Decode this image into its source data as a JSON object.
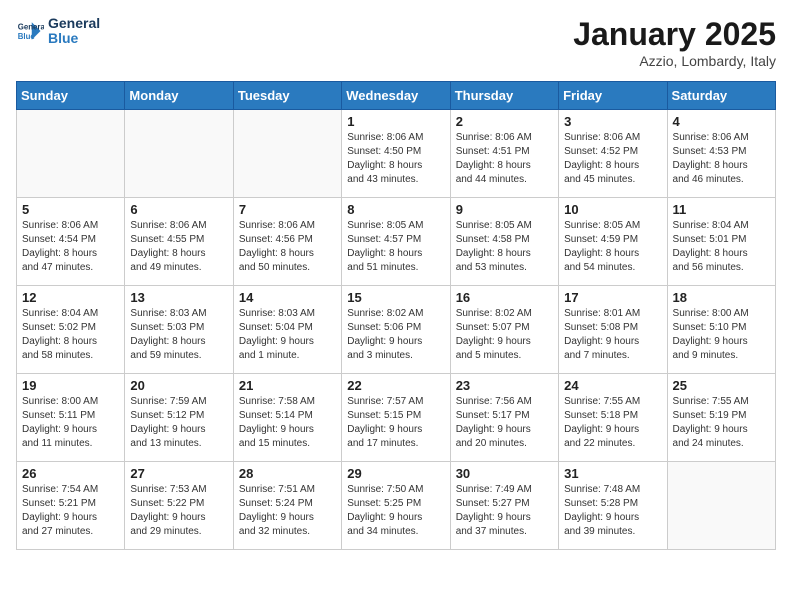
{
  "header": {
    "logo_line1": "General",
    "logo_line2": "Blue",
    "month": "January 2025",
    "location": "Azzio, Lombardy, Italy"
  },
  "weekdays": [
    "Sunday",
    "Monday",
    "Tuesday",
    "Wednesday",
    "Thursday",
    "Friday",
    "Saturday"
  ],
  "weeks": [
    [
      {
        "day": "",
        "info": ""
      },
      {
        "day": "",
        "info": ""
      },
      {
        "day": "",
        "info": ""
      },
      {
        "day": "1",
        "info": "Sunrise: 8:06 AM\nSunset: 4:50 PM\nDaylight: 8 hours\nand 43 minutes."
      },
      {
        "day": "2",
        "info": "Sunrise: 8:06 AM\nSunset: 4:51 PM\nDaylight: 8 hours\nand 44 minutes."
      },
      {
        "day": "3",
        "info": "Sunrise: 8:06 AM\nSunset: 4:52 PM\nDaylight: 8 hours\nand 45 minutes."
      },
      {
        "day": "4",
        "info": "Sunrise: 8:06 AM\nSunset: 4:53 PM\nDaylight: 8 hours\nand 46 minutes."
      }
    ],
    [
      {
        "day": "5",
        "info": "Sunrise: 8:06 AM\nSunset: 4:54 PM\nDaylight: 8 hours\nand 47 minutes."
      },
      {
        "day": "6",
        "info": "Sunrise: 8:06 AM\nSunset: 4:55 PM\nDaylight: 8 hours\nand 49 minutes."
      },
      {
        "day": "7",
        "info": "Sunrise: 8:06 AM\nSunset: 4:56 PM\nDaylight: 8 hours\nand 50 minutes."
      },
      {
        "day": "8",
        "info": "Sunrise: 8:05 AM\nSunset: 4:57 PM\nDaylight: 8 hours\nand 51 minutes."
      },
      {
        "day": "9",
        "info": "Sunrise: 8:05 AM\nSunset: 4:58 PM\nDaylight: 8 hours\nand 53 minutes."
      },
      {
        "day": "10",
        "info": "Sunrise: 8:05 AM\nSunset: 4:59 PM\nDaylight: 8 hours\nand 54 minutes."
      },
      {
        "day": "11",
        "info": "Sunrise: 8:04 AM\nSunset: 5:01 PM\nDaylight: 8 hours\nand 56 minutes."
      }
    ],
    [
      {
        "day": "12",
        "info": "Sunrise: 8:04 AM\nSunset: 5:02 PM\nDaylight: 8 hours\nand 58 minutes."
      },
      {
        "day": "13",
        "info": "Sunrise: 8:03 AM\nSunset: 5:03 PM\nDaylight: 8 hours\nand 59 minutes."
      },
      {
        "day": "14",
        "info": "Sunrise: 8:03 AM\nSunset: 5:04 PM\nDaylight: 9 hours\nand 1 minute."
      },
      {
        "day": "15",
        "info": "Sunrise: 8:02 AM\nSunset: 5:06 PM\nDaylight: 9 hours\nand 3 minutes."
      },
      {
        "day": "16",
        "info": "Sunrise: 8:02 AM\nSunset: 5:07 PM\nDaylight: 9 hours\nand 5 minutes."
      },
      {
        "day": "17",
        "info": "Sunrise: 8:01 AM\nSunset: 5:08 PM\nDaylight: 9 hours\nand 7 minutes."
      },
      {
        "day": "18",
        "info": "Sunrise: 8:00 AM\nSunset: 5:10 PM\nDaylight: 9 hours\nand 9 minutes."
      }
    ],
    [
      {
        "day": "19",
        "info": "Sunrise: 8:00 AM\nSunset: 5:11 PM\nDaylight: 9 hours\nand 11 minutes."
      },
      {
        "day": "20",
        "info": "Sunrise: 7:59 AM\nSunset: 5:12 PM\nDaylight: 9 hours\nand 13 minutes."
      },
      {
        "day": "21",
        "info": "Sunrise: 7:58 AM\nSunset: 5:14 PM\nDaylight: 9 hours\nand 15 minutes."
      },
      {
        "day": "22",
        "info": "Sunrise: 7:57 AM\nSunset: 5:15 PM\nDaylight: 9 hours\nand 17 minutes."
      },
      {
        "day": "23",
        "info": "Sunrise: 7:56 AM\nSunset: 5:17 PM\nDaylight: 9 hours\nand 20 minutes."
      },
      {
        "day": "24",
        "info": "Sunrise: 7:55 AM\nSunset: 5:18 PM\nDaylight: 9 hours\nand 22 minutes."
      },
      {
        "day": "25",
        "info": "Sunrise: 7:55 AM\nSunset: 5:19 PM\nDaylight: 9 hours\nand 24 minutes."
      }
    ],
    [
      {
        "day": "26",
        "info": "Sunrise: 7:54 AM\nSunset: 5:21 PM\nDaylight: 9 hours\nand 27 minutes."
      },
      {
        "day": "27",
        "info": "Sunrise: 7:53 AM\nSunset: 5:22 PM\nDaylight: 9 hours\nand 29 minutes."
      },
      {
        "day": "28",
        "info": "Sunrise: 7:51 AM\nSunset: 5:24 PM\nDaylight: 9 hours\nand 32 minutes."
      },
      {
        "day": "29",
        "info": "Sunrise: 7:50 AM\nSunset: 5:25 PM\nDaylight: 9 hours\nand 34 minutes."
      },
      {
        "day": "30",
        "info": "Sunrise: 7:49 AM\nSunset: 5:27 PM\nDaylight: 9 hours\nand 37 minutes."
      },
      {
        "day": "31",
        "info": "Sunrise: 7:48 AM\nSunset: 5:28 PM\nDaylight: 9 hours\nand 39 minutes."
      },
      {
        "day": "",
        "info": ""
      }
    ]
  ]
}
